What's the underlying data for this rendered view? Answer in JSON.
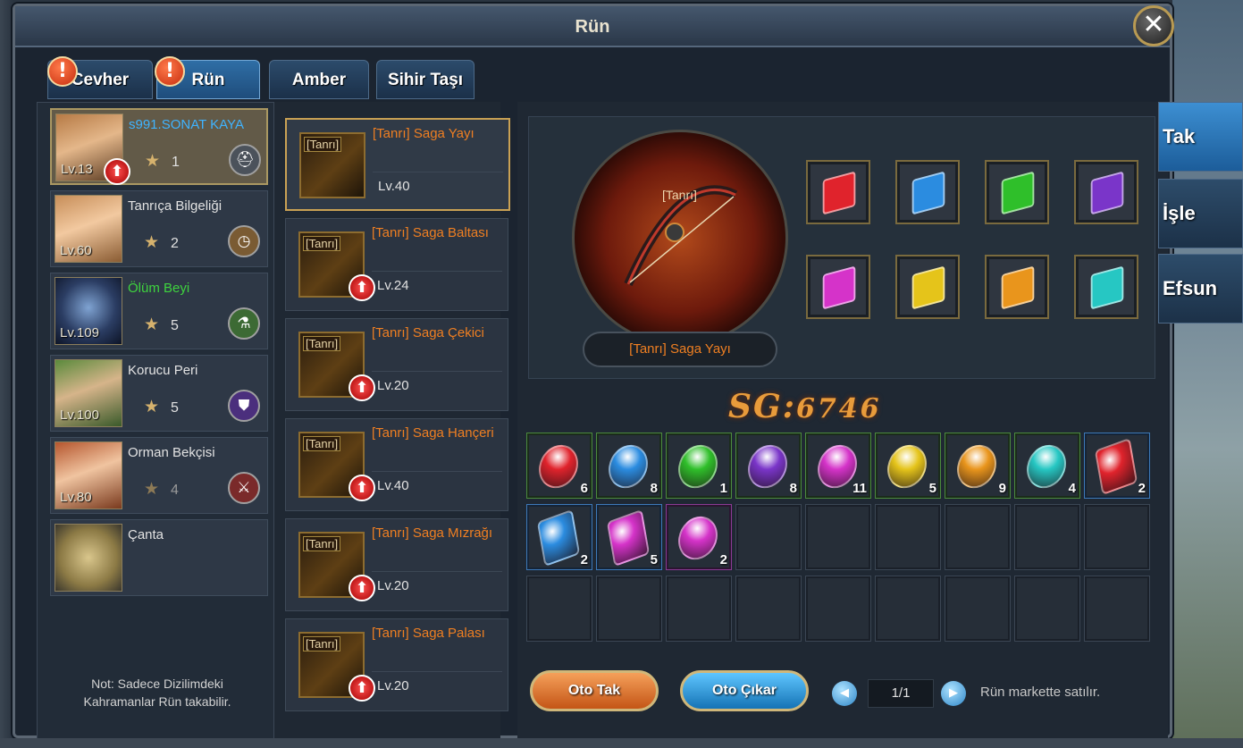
{
  "window": {
    "title": "Rün"
  },
  "tabs": [
    {
      "label": "Cevher",
      "alert": "!"
    },
    {
      "label": "Rün",
      "alert": "!"
    },
    {
      "label": "Amber"
    },
    {
      "label": "Sihir Taşı"
    }
  ],
  "side_menu": [
    {
      "label": "Tak"
    },
    {
      "label": "İşle"
    },
    {
      "label": "Efsun"
    }
  ],
  "heroes": [
    {
      "name": "s991.SONAT KAYA",
      "level": "Lv.13",
      "stars": "1",
      "name_color": "#3fb3ff",
      "role_icon": "helmet-icon",
      "has_upgrade": true
    },
    {
      "name": "Tanrıça Bilgeliği",
      "level": "Lv.60",
      "stars": "2",
      "name_color": "#e2e2e2",
      "role_icon": "clock-icon"
    },
    {
      "name": "Ölüm Beyi",
      "level": "Lv.109",
      "stars": "5",
      "name_color": "#3ed33e",
      "role_icon": "potion-icon"
    },
    {
      "name": "Korucu Peri",
      "level": "Lv.100",
      "stars": "5",
      "name_color": "#e2e2e2",
      "role_icon": "shield-icon"
    },
    {
      "name": "Orman Bekçisi",
      "level": "Lv.80",
      "stars": "4",
      "name_color": "#e2e2e2",
      "role_icon": "crossed-swords-icon"
    },
    {
      "name": "Çanta",
      "level": "",
      "stars": "",
      "name_color": "#e2e2e2",
      "role_icon": "bag-icon"
    }
  ],
  "note": "Not: Sadece Dizilimdeki Kahramanlar Rün takabilir.",
  "items": [
    {
      "tag": "[Tanrı]",
      "name": "[Tanrı] Saga Yayı",
      "level": "Lv.40",
      "icon": "bow-icon"
    },
    {
      "tag": "[Tanrı]",
      "name": "[Tanrı] Saga Baltası",
      "level": "Lv.24",
      "icon": "axe-icon"
    },
    {
      "tag": "[Tanrı]",
      "name": "[Tanrı] Saga Çekici",
      "level": "Lv.20",
      "icon": "hammer-icon"
    },
    {
      "tag": "[Tanrı]",
      "name": "[Tanrı] Saga Hançeri",
      "level": "Lv.40",
      "icon": "dagger-icon"
    },
    {
      "tag": "[Tanrı]",
      "name": "[Tanrı] Saga Mızrağı",
      "level": "Lv.20",
      "icon": "spear-icon"
    },
    {
      "tag": "[Tanrı]",
      "name": "[Tanrı] Saga Palası",
      "level": "Lv.20",
      "icon": "sword-icon"
    }
  ],
  "equipped": {
    "tag": "[Tanrı]",
    "name": "[Tanrı] Saga Yayı"
  },
  "socket_colors": [
    "#e0232c",
    "#2b8ce0",
    "#2fbf2a",
    "#7a35c9",
    "#d533c9",
    "#e5c41a",
    "#e9951c",
    "#26c7c3"
  ],
  "sg": {
    "label": "SG",
    "separator": ":",
    "value": "6746"
  },
  "inventory": [
    {
      "color": "#e0232c",
      "count": "6",
      "border": "green",
      "shape": "egg"
    },
    {
      "color": "#2b8ce0",
      "count": "8",
      "border": "green",
      "shape": "egg"
    },
    {
      "color": "#2fbf2a",
      "count": "1",
      "border": "green",
      "shape": "egg"
    },
    {
      "color": "#7a35c9",
      "count": "8",
      "border": "green",
      "shape": "egg"
    },
    {
      "color": "#d533c9",
      "count": "11",
      "border": "green",
      "shape": "egg"
    },
    {
      "color": "#e5c41a",
      "count": "5",
      "border": "green",
      "shape": "egg"
    },
    {
      "color": "#e9951c",
      "count": "9",
      "border": "green",
      "shape": "egg"
    },
    {
      "color": "#26c7c3",
      "count": "4",
      "border": "green",
      "shape": "egg"
    },
    {
      "color": "#e0232c",
      "count": "2",
      "border": "blue",
      "shape": "gem"
    },
    {
      "color": "#2b8ce0",
      "count": "2",
      "border": "blue",
      "shape": "gem"
    },
    {
      "color": "#d533c9",
      "count": "5",
      "border": "blue",
      "shape": "gem"
    },
    {
      "color": "#d533c9",
      "count": "2",
      "border": "purple",
      "shape": "egg"
    }
  ],
  "buttons": {
    "auto_equip": "Oto Tak",
    "auto_remove": "Oto Çıkar"
  },
  "pagination": {
    "text": "1/1"
  },
  "market_note": "Rün markette satılır."
}
